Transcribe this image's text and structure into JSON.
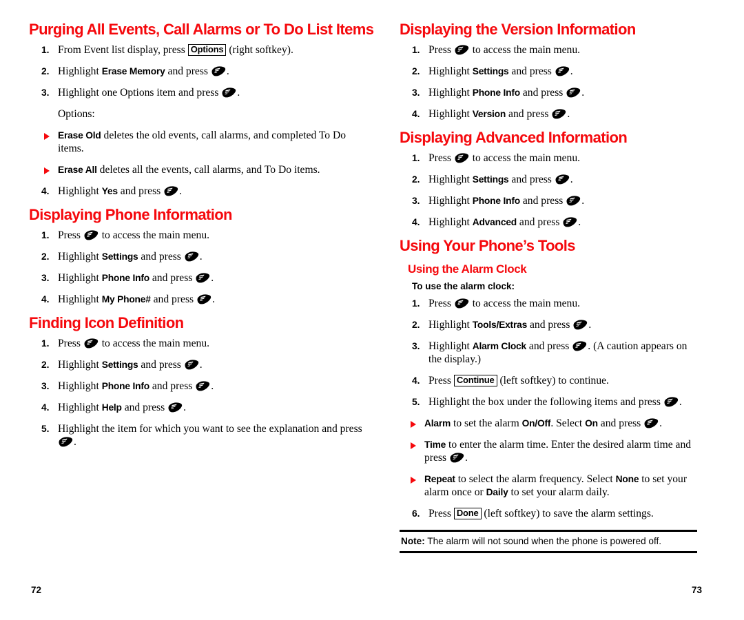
{
  "colors": {
    "heading_red": "#F5090D",
    "text_black": "#000000",
    "page_background": "#FFFFFF"
  },
  "icons": {
    "ok_key": "phone-ok-key-icon",
    "bullet": "red-triangle-bullet-icon"
  },
  "left_page": {
    "folio": "72",
    "sections": [
      {
        "heading": "Purging All Events, Call Alarms or To Do List Items",
        "steps": [
          {
            "num": "1.",
            "parts": [
              {
                "t": "text",
                "v": "From Event list display, press "
              },
              {
                "t": "key",
                "v": "Options"
              },
              {
                "t": "text",
                "v": " (right softkey)."
              }
            ]
          },
          {
            "num": "2.",
            "parts": [
              {
                "t": "text",
                "v": "Highlight "
              },
              {
                "t": "ui",
                "v": "Erase Memory"
              },
              {
                "t": "text",
                "v": " and press "
              },
              {
                "t": "okkey",
                "v": "ok-key"
              },
              {
                "t": "text",
                "v": "."
              }
            ]
          },
          {
            "num": "3.",
            "parts": [
              {
                "t": "text",
                "v": "Highlight one Options item and press "
              },
              {
                "t": "okkey",
                "v": "ok-key"
              },
              {
                "t": "text",
                "v": "."
              }
            ]
          }
        ],
        "plain_line": "Options:",
        "bullets": [
          {
            "parts": [
              {
                "t": "ui",
                "v": "Erase Old"
              },
              {
                "t": "text",
                "v": " deletes the old events, call alarms, and completed To Do items."
              }
            ]
          },
          {
            "parts": [
              {
                "t": "ui",
                "v": "Erase All"
              },
              {
                "t": "text",
                "v": " deletes all the events, call alarms, and To Do items."
              }
            ]
          }
        ],
        "steps_after": [
          {
            "num": "4.",
            "parts": [
              {
                "t": "text",
                "v": "Highlight "
              },
              {
                "t": "ui",
                "v": "Yes"
              },
              {
                "t": "text",
                "v": " and press "
              },
              {
                "t": "okkey",
                "v": "ok-key"
              },
              {
                "t": "text",
                "v": "."
              }
            ]
          }
        ]
      },
      {
        "heading": "Displaying Phone Information",
        "steps": [
          {
            "num": "1.",
            "parts": [
              {
                "t": "text",
                "v": "Press "
              },
              {
                "t": "okkey",
                "v": "ok-key"
              },
              {
                "t": "text",
                "v": " to access the main menu."
              }
            ]
          },
          {
            "num": "2.",
            "parts": [
              {
                "t": "text",
                "v": "Highlight "
              },
              {
                "t": "ui",
                "v": "Settings"
              },
              {
                "t": "text",
                "v": " and press "
              },
              {
                "t": "okkey",
                "v": "ok-key"
              },
              {
                "t": "text",
                "v": "."
              }
            ]
          },
          {
            "num": "3.",
            "parts": [
              {
                "t": "text",
                "v": "Highlight "
              },
              {
                "t": "ui",
                "v": "Phone Info"
              },
              {
                "t": "text",
                "v": " and press "
              },
              {
                "t": "okkey",
                "v": "ok-key"
              },
              {
                "t": "text",
                "v": "."
              }
            ]
          },
          {
            "num": "4.",
            "parts": [
              {
                "t": "text",
                "v": "Highlight "
              },
              {
                "t": "ui",
                "v": "My Phone#"
              },
              {
                "t": "text",
                "v": " and press "
              },
              {
                "t": "okkey",
                "v": "ok-key"
              },
              {
                "t": "text",
                "v": "."
              }
            ]
          }
        ]
      },
      {
        "heading": "Finding Icon Definition",
        "steps": [
          {
            "num": "1.",
            "parts": [
              {
                "t": "text",
                "v": "Press "
              },
              {
                "t": "okkey",
                "v": "ok-key"
              },
              {
                "t": "text",
                "v": " to access the main menu."
              }
            ]
          },
          {
            "num": "2.",
            "parts": [
              {
                "t": "text",
                "v": "Highlight "
              },
              {
                "t": "ui",
                "v": "Settings"
              },
              {
                "t": "text",
                "v": " and press "
              },
              {
                "t": "okkey",
                "v": "ok-key"
              },
              {
                "t": "text",
                "v": "."
              }
            ]
          },
          {
            "num": "3.",
            "parts": [
              {
                "t": "text",
                "v": "Highlight "
              },
              {
                "t": "ui",
                "v": "Phone Info"
              },
              {
                "t": "text",
                "v": " and press "
              },
              {
                "t": "okkey",
                "v": "ok-key"
              },
              {
                "t": "text",
                "v": "."
              }
            ]
          },
          {
            "num": "4.",
            "parts": [
              {
                "t": "text",
                "v": "Highlight "
              },
              {
                "t": "ui",
                "v": "Help"
              },
              {
                "t": "text",
                "v": " and press "
              },
              {
                "t": "okkey",
                "v": "ok-key"
              },
              {
                "t": "text",
                "v": "."
              }
            ]
          },
          {
            "num": "5.",
            "parts": [
              {
                "t": "text",
                "v": "Highlight the item for which you want to see the explanation and press "
              },
              {
                "t": "okkey",
                "v": "ok-key"
              },
              {
                "t": "text",
                "v": "."
              }
            ]
          }
        ]
      }
    ]
  },
  "right_page": {
    "folio": "73",
    "sections": [
      {
        "heading": "Displaying the Version Information",
        "steps": [
          {
            "num": "1.",
            "parts": [
              {
                "t": "text",
                "v": "Press "
              },
              {
                "t": "okkey",
                "v": "ok-key"
              },
              {
                "t": "text",
                "v": " to access the main menu."
              }
            ]
          },
          {
            "num": "2.",
            "parts": [
              {
                "t": "text",
                "v": "Highlight "
              },
              {
                "t": "ui",
                "v": "Settings"
              },
              {
                "t": "text",
                "v": " and press "
              },
              {
                "t": "okkey",
                "v": "ok-key"
              },
              {
                "t": "text",
                "v": "."
              }
            ]
          },
          {
            "num": "3.",
            "parts": [
              {
                "t": "text",
                "v": "Highlight "
              },
              {
                "t": "ui",
                "v": "Phone Info"
              },
              {
                "t": "text",
                "v": " and press "
              },
              {
                "t": "okkey",
                "v": "ok-key"
              },
              {
                "t": "text",
                "v": "."
              }
            ]
          },
          {
            "num": "4.",
            "parts": [
              {
                "t": "text",
                "v": "Highlight "
              },
              {
                "t": "ui",
                "v": "Version"
              },
              {
                "t": "text",
                "v": " and press "
              },
              {
                "t": "okkey",
                "v": "ok-key"
              },
              {
                "t": "text",
                "v": "."
              }
            ]
          }
        ]
      },
      {
        "heading": "Displaying Advanced Information",
        "steps": [
          {
            "num": "1.",
            "parts": [
              {
                "t": "text",
                "v": "Press "
              },
              {
                "t": "okkey",
                "v": "ok-key"
              },
              {
                "t": "text",
                "v": " to access the main menu."
              }
            ]
          },
          {
            "num": "2.",
            "parts": [
              {
                "t": "text",
                "v": "Highlight "
              },
              {
                "t": "ui",
                "v": "Settings"
              },
              {
                "t": "text",
                "v": " and press "
              },
              {
                "t": "okkey",
                "v": "ok-key"
              },
              {
                "t": "text",
                "v": "."
              }
            ]
          },
          {
            "num": "3.",
            "parts": [
              {
                "t": "text",
                "v": "Highlight "
              },
              {
                "t": "ui",
                "v": "Phone Info"
              },
              {
                "t": "text",
                "v": " and press "
              },
              {
                "t": "okkey",
                "v": "ok-key"
              },
              {
                "t": "text",
                "v": "."
              }
            ]
          },
          {
            "num": "4.",
            "parts": [
              {
                "t": "text",
                "v": "Highlight "
              },
              {
                "t": "ui",
                "v": "Advanced"
              },
              {
                "t": "text",
                "v": " and press "
              },
              {
                "t": "okkey",
                "v": "ok-key"
              },
              {
                "t": "text",
                "v": "."
              }
            ]
          }
        ]
      }
    ],
    "tools": {
      "heading": "Using Your Phone’s Tools",
      "subheading": "Using the Alarm Clock",
      "lead": "To use the alarm clock:",
      "steps": [
        {
          "num": "1.",
          "parts": [
            {
              "t": "text",
              "v": "Press "
            },
            {
              "t": "okkey",
              "v": "ok-key"
            },
            {
              "t": "text",
              "v": " to access the main menu."
            }
          ]
        },
        {
          "num": "2.",
          "parts": [
            {
              "t": "text",
              "v": "Highlight "
            },
            {
              "t": "ui",
              "v": "Tools/Extras"
            },
            {
              "t": "text",
              "v": " and press "
            },
            {
              "t": "okkey",
              "v": "ok-key"
            },
            {
              "t": "text",
              "v": "."
            }
          ]
        },
        {
          "num": "3.",
          "parts": [
            {
              "t": "text",
              "v": "Highlight "
            },
            {
              "t": "ui",
              "v": "Alarm Clock"
            },
            {
              "t": "text",
              "v": " and press "
            },
            {
              "t": "okkey",
              "v": "ok-key"
            },
            {
              "t": "text",
              "v": ". (A caution appears on the display.)"
            }
          ]
        },
        {
          "num": "4.",
          "parts": [
            {
              "t": "text",
              "v": "Press "
            },
            {
              "t": "key",
              "v": "Continue"
            },
            {
              "t": "text",
              "v": " (left softkey) to continue."
            }
          ]
        },
        {
          "num": "5.",
          "parts": [
            {
              "t": "text",
              "v": "Highlight the box under the following items and press "
            },
            {
              "t": "okkey",
              "v": "ok-key"
            },
            {
              "t": "text",
              "v": "."
            }
          ]
        }
      ],
      "bullets": [
        {
          "parts": [
            {
              "t": "ui",
              "v": "Alarm"
            },
            {
              "t": "text",
              "v": " to set the alarm "
            },
            {
              "t": "ui",
              "v": "On/Off"
            },
            {
              "t": "text",
              "v": ". Select "
            },
            {
              "t": "ui",
              "v": "On"
            },
            {
              "t": "text",
              "v": " and press "
            },
            {
              "t": "okkey",
              "v": "ok-key"
            },
            {
              "t": "text",
              "v": "."
            }
          ]
        },
        {
          "parts": [
            {
              "t": "ui",
              "v": "Time"
            },
            {
              "t": "text",
              "v": " to enter the alarm time. Enter the desired alarm time and press "
            },
            {
              "t": "okkey",
              "v": "ok-key"
            },
            {
              "t": "text",
              "v": "."
            }
          ]
        },
        {
          "parts": [
            {
              "t": "ui",
              "v": "Repeat"
            },
            {
              "t": "text",
              "v": " to select the alarm frequency. Select "
            },
            {
              "t": "ui",
              "v": "None"
            },
            {
              "t": "text",
              "v": " to set your alarm once or "
            },
            {
              "t": "ui",
              "v": "Daily"
            },
            {
              "t": "text",
              "v": " to set your alarm daily."
            }
          ]
        }
      ],
      "steps_after": [
        {
          "num": "6.",
          "parts": [
            {
              "t": "text",
              "v": "Press "
            },
            {
              "t": "key",
              "v": "Done"
            },
            {
              "t": "text",
              "v": " (left softkey) to save the alarm settings."
            }
          ]
        }
      ],
      "note": {
        "label": "Note:",
        "text": " The alarm will not sound when the phone is powered off."
      }
    }
  }
}
